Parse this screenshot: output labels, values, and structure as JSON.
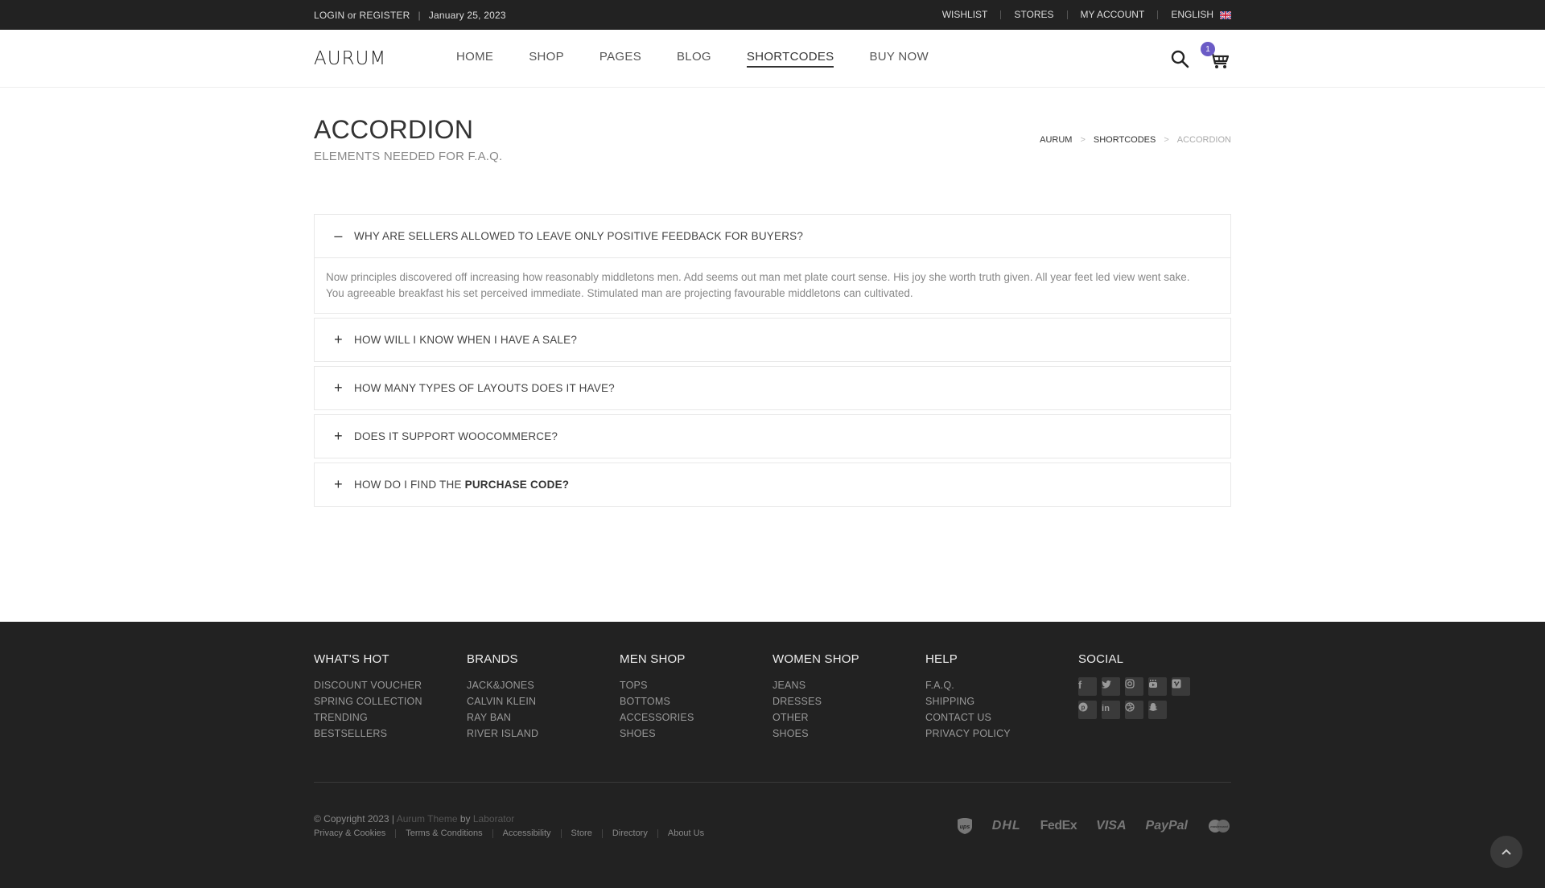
{
  "topbar": {
    "login": "LOGIN",
    "or": "or",
    "register": "REGISTER",
    "date": "January 25, 2023",
    "links": [
      "WISHLIST",
      "STORES",
      "MY ACCOUNT"
    ],
    "language": "ENGLISH"
  },
  "header": {
    "logo": "AURUM",
    "nav": [
      "HOME",
      "SHOP",
      "PAGES",
      "BLOG",
      "SHORTCODES",
      "BUY NOW"
    ],
    "active_nav": "SHORTCODES",
    "cart_count": "1"
  },
  "page": {
    "title": "ACCORDION",
    "subtitle": "ELEMENTS NEEDED FOR F.A.Q.",
    "breadcrumb": [
      "AURUM",
      "SHORTCODES",
      "ACCORDION"
    ]
  },
  "accordion": [
    {
      "question": "WHY ARE SELLERS ALLOWED TO LEAVE ONLY POSITIVE FEEDBACK FOR BUYERS?",
      "open": true,
      "answer_line1": "Now principles discovered off increasing how reasonably middletons men. Add seems out man met plate court sense. His joy she worth truth given. All year feet led view went sake.",
      "answer_line2": "You agreeable breakfast his set perceived immediate. Stimulated man are projecting favourable middletons can cultivated."
    },
    {
      "question": "HOW WILL I KNOW WHEN I HAVE A SALE?",
      "open": false
    },
    {
      "question": "HOW MANY TYPES OF LAYOUTS DOES IT HAVE?",
      "open": false
    },
    {
      "question": "DOES IT SUPPORT WOOCOMMERCE?",
      "open": false
    },
    {
      "question": "HOW DO I FIND THE",
      "question_bold": "PURCHASE CODE?",
      "open": false
    }
  ],
  "footer": {
    "columns": [
      {
        "title": "WHAT'S HOT",
        "links": [
          "DISCOUNT VOUCHER",
          "SPRING COLLECTION",
          "TRENDING",
          "BESTSELLERS"
        ]
      },
      {
        "title": "BRANDS",
        "links": [
          "JACK&JONES",
          "CALVIN KLEIN",
          "RAY BAN",
          "RIVER ISLAND"
        ]
      },
      {
        "title": "MEN SHOP",
        "links": [
          "TOPS",
          "BOTTOMS",
          "ACCESSORIES",
          "SHOES"
        ]
      },
      {
        "title": "WOMEN SHOP",
        "links": [
          "JEANS",
          "DRESSES",
          "OTHER",
          "SHOES"
        ]
      },
      {
        "title": "HELP",
        "links": [
          "F.A.Q.",
          "SHIPPING",
          "CONTACT US",
          "PRIVACY POLICY"
        ]
      }
    ],
    "social_title": "SOCIAL",
    "social_icons": [
      "facebook-icon",
      "twitter-icon",
      "instagram-icon",
      "youtube-icon",
      "vimeo-icon",
      "pinterest-icon",
      "linkedin-icon",
      "dribbble-icon",
      "snapchat-icon"
    ],
    "copyright": "© Copyright 2023 |",
    "theme": "Aurum Theme",
    "by": "by",
    "author": "Laborator",
    "bottom_links": [
      "Privacy & Cookies",
      "Terms & Conditions",
      "Accessibility",
      "Store",
      "Directory",
      "About Us"
    ],
    "payments": [
      "ups",
      "DHL",
      "FedEx",
      "VISA",
      "PayPal",
      "mastercard"
    ]
  },
  "colors": {
    "topbar_bg": "#222222",
    "footer_bg": "#222222",
    "badge": "#6b5bc6"
  }
}
